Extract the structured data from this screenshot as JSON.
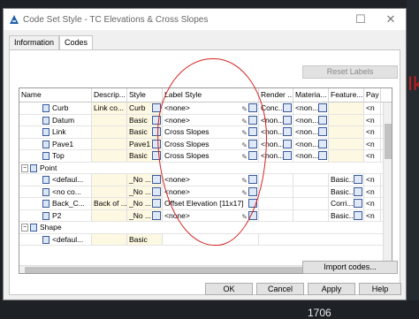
{
  "window": {
    "title": "Code Set Style - TC Elevations & Cross Slopes",
    "close_glyph": "✕",
    "max_glyph": "☐"
  },
  "tabs": [
    {
      "label": "Information"
    },
    {
      "label": "Codes"
    }
  ],
  "reset_label": "Reset Labels",
  "import_label": "Import codes...",
  "columns": [
    "Name",
    "Descrip...",
    "Style",
    "Label Style",
    "Render ...",
    "Materia...",
    "Feature...",
    "Pay It"
  ],
  "rows": [
    {
      "name": "Curb",
      "desc": "Link co...",
      "style": "Curb",
      "label": "<none>",
      "render": "Conc...",
      "material": "<non...",
      "feature": "",
      "pay": "<n"
    },
    {
      "name": "Datum",
      "desc": "",
      "style": "Basic",
      "label": "<none>",
      "render": "<non...",
      "material": "<non...",
      "feature": "",
      "pay": "<n"
    },
    {
      "name": "Link",
      "desc": "",
      "style": "Basic",
      "label": "Cross Slopes",
      "render": "<non...",
      "material": "<non...",
      "feature": "",
      "pay": "<n"
    },
    {
      "name": "Pave1",
      "desc": "",
      "style": "Pave1",
      "label": "Cross Slopes",
      "render": "<non...",
      "material": "<non...",
      "feature": "",
      "pay": "<n"
    },
    {
      "name": "Top",
      "desc": "",
      "style": "Basic",
      "label": "Cross Slopes",
      "render": "<non...",
      "material": "<non...",
      "feature": "",
      "pay": "<n"
    }
  ],
  "group_point": "Point",
  "point_rows": [
    {
      "name": "<defaul...",
      "desc": "",
      "style": "_No ...",
      "label": "<none>",
      "feature": "Basic...",
      "pay": "<n"
    },
    {
      "name": "<no co...",
      "desc": "",
      "style": "_No ...",
      "label": "<none>",
      "feature": "Basic...",
      "pay": "<n"
    },
    {
      "name": "Back_C...",
      "desc": "Back of ...",
      "style": "_No ...",
      "label": "Offset Elevation [11x17]",
      "feature": "Corri...",
      "pay": "<n"
    },
    {
      "name": "P2",
      "desc": "",
      "style": "_No ...",
      "label": "<none>",
      "feature": "Basic...",
      "pay": "<n"
    }
  ],
  "group_shape": "Shape",
  "shape_rows": [
    {
      "name": "<defaul...",
      "style": "Basic"
    }
  ],
  "buttons": {
    "ok": "OK",
    "cancel": "Cancel",
    "apply": "Apply",
    "help": "Help"
  },
  "background": {
    "red_mark": "Ik",
    "bottom_number": "1706"
  },
  "colors": {
    "annotation": "#d42020",
    "yellow_cell": "#fdf8e2"
  }
}
